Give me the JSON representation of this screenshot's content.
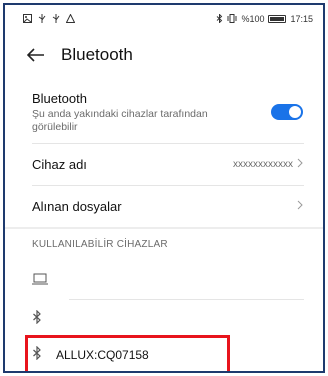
{
  "status_bar": {
    "left_icons": [
      "image-icon",
      "usb-icon",
      "usb-icon",
      "warning-icon"
    ],
    "battery_text": "%100",
    "time": "17:15",
    "battery_level": 1.0
  },
  "header": {
    "title": "Bluetooth"
  },
  "bluetooth_toggle": {
    "title": "Bluetooth",
    "subtitle": "Şu anda yakındaki cihazlar tarafından görülebilir",
    "enabled": true
  },
  "device_name_row": {
    "label": "Cihaz adı",
    "value": "xxxxxxxxxxxx"
  },
  "received_files_row": {
    "label": "Alınan dosyalar"
  },
  "available_devices": {
    "section_title": "KULLANILABİLİR CİHAZLAR",
    "items": [
      {
        "icon": "laptop-icon",
        "name": ""
      },
      {
        "icon": "bluetooth-icon",
        "name": ""
      },
      {
        "icon": "bluetooth-icon",
        "name": "ALLUX:CQ07158"
      }
    ]
  },
  "colors": {
    "accent": "#1a73e8",
    "highlight": "#e8141c",
    "frame": "#1e3a6e"
  }
}
